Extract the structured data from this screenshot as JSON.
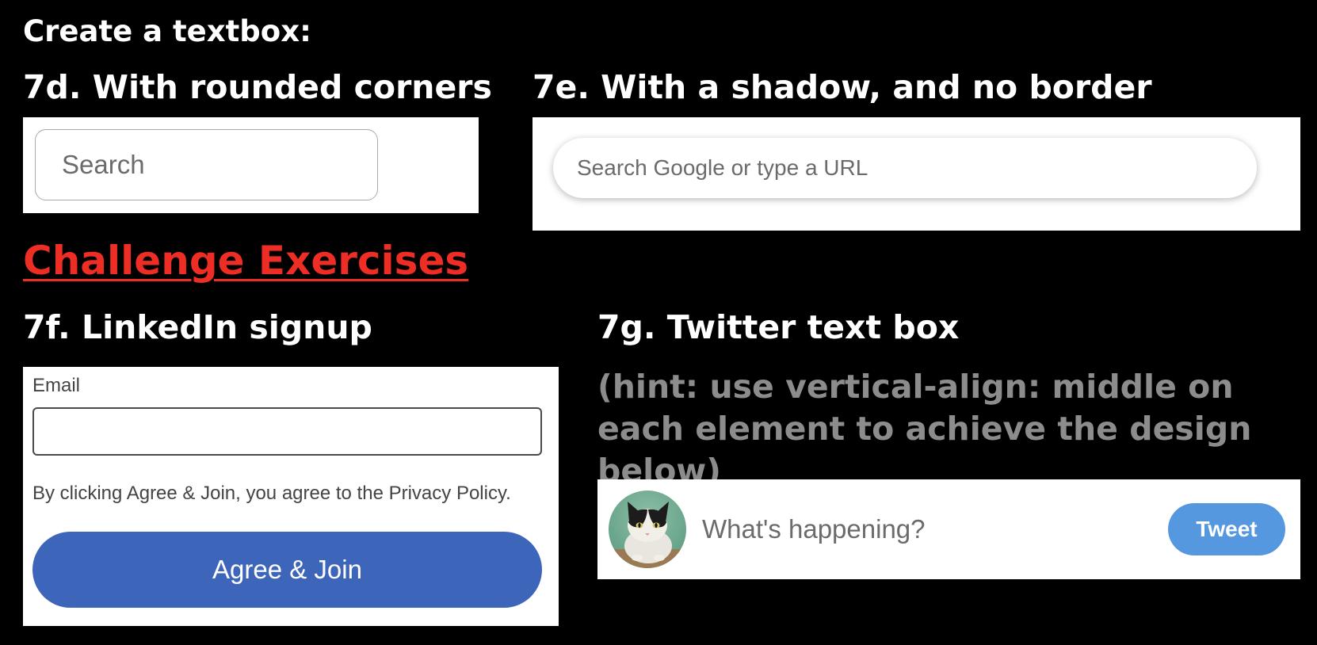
{
  "title": "Create a textbox:",
  "sections": {
    "rounded": {
      "heading": "7d. With rounded corners",
      "input_placeholder": "Search"
    },
    "shadow": {
      "heading": "7e. With a shadow, and no border",
      "input_placeholder": "Search Google or type a URL"
    }
  },
  "challenge": {
    "heading": "Challenge Exercises",
    "color": "#ee2e24"
  },
  "linkedin": {
    "heading": "7f. LinkedIn signup",
    "email_label": "Email",
    "email_value": "",
    "privacy_text": "By clicking Agree & Join, you agree to the Privacy Policy.",
    "button_label": "Agree & Join",
    "button_color": "#3d65b9"
  },
  "twitter": {
    "heading": "7g. Twitter text box",
    "hint": "(hint: use vertical-align: middle on each element to achieve the design below)",
    "input_placeholder": "What's happening?",
    "button_label": "Tweet",
    "button_color": "#5698e0",
    "avatar_icon": "cat-avatar"
  }
}
